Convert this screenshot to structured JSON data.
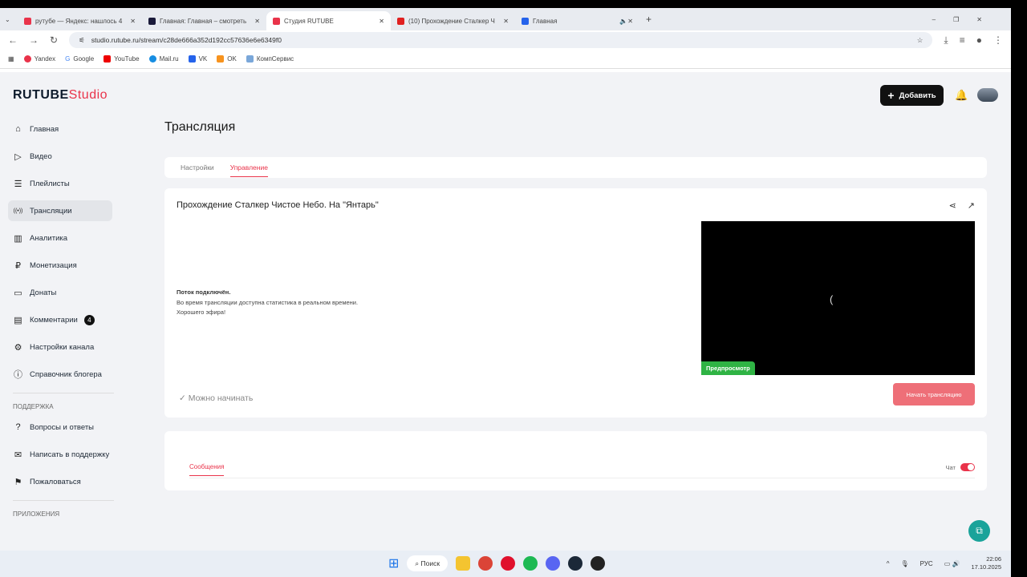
{
  "browser": {
    "tabs": [
      {
        "label": "рутубе — Яндекс: нашлось 4",
        "color": "#e9334a"
      },
      {
        "label": "Главная: Главная – смотреть",
        "color": "#1a1a3a"
      },
      {
        "label": "Студия RUTUBE",
        "color": "#e9334a"
      },
      {
        "label": "(10) Прохождение Сталкер Ч",
        "color": "#e02020"
      },
      {
        "label": "Главная",
        "color": "#2563eb"
      }
    ],
    "url": "studio.rutube.ru/stream/c28de666a352d192cc57636e6e6349f0",
    "bookmarks": [
      "Yandex",
      "Google",
      "YouTube",
      "Mail.ru",
      "VK",
      "OK",
      "КомпСервис"
    ]
  },
  "header": {
    "logo_main": "RUTUBE",
    "logo_studio": "Studio",
    "add_label": "Добавить"
  },
  "sidebar": {
    "items": [
      {
        "label": "Главная",
        "icon": "⌂"
      },
      {
        "label": "Видео",
        "icon": "▷"
      },
      {
        "label": "Плейлисты",
        "icon": "☰"
      },
      {
        "label": "Трансляции",
        "icon": "((•))"
      },
      {
        "label": "Аналитика",
        "icon": "▥"
      },
      {
        "label": "Монетизация",
        "icon": "₽"
      },
      {
        "label": "Донаты",
        "icon": "▭"
      },
      {
        "label": "Комментарии",
        "icon": "▤",
        "badge": "4"
      },
      {
        "label": "Настройки канала",
        "icon": "⚙"
      },
      {
        "label": "Справочник блогера",
        "icon": "ⓘ"
      }
    ],
    "support_title": "ПОДДЕРЖКА",
    "support": [
      {
        "label": "Вопросы и ответы",
        "icon": "?"
      },
      {
        "label": "Написать в поддержку",
        "icon": "✉"
      },
      {
        "label": "Пожаловаться",
        "icon": "⚑"
      }
    ],
    "apps_title": "ПРИЛОЖЕНИЯ"
  },
  "main": {
    "page_title": "Трансляция",
    "tabs": [
      "Настройки",
      "Управление"
    ],
    "stream_title": "Прохождение Сталкер Чистое Небо. На \"Янтарь\"",
    "status_title": "Поток подключён.",
    "status_line1": "Во время трансляции доступна статистика в реальном времени.",
    "status_line2": "Хорошего эфира!",
    "preview_label": "Предпросмотр",
    "ready_label": "Можно начинать",
    "start_button": "Начать трансляцию"
  },
  "chat": {
    "tab": "Сообщения",
    "toggle_label": "Чат",
    "toggle_on": true
  },
  "taskbar": {
    "search": "Поиск",
    "lang": "РУС",
    "time": "22:06",
    "date": "17.10.2025"
  }
}
